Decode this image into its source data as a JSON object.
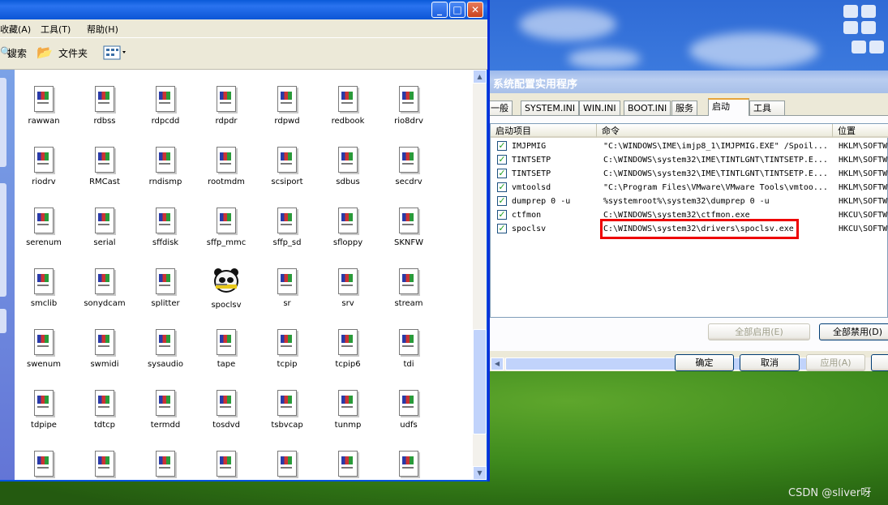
{
  "explorer": {
    "menu": [
      "收藏(A)",
      "工具(T)",
      "帮助(H)"
    ],
    "toolbar": {
      "search_label": "搜索",
      "folders_label": "文件夹"
    },
    "files": [
      [
        "rawwan",
        "rdbss",
        "rdpcdd",
        "rdpdr",
        "rdpwd",
        "redbook",
        "rio8drv"
      ],
      [
        "riodrv",
        "RMCast",
        "rndismp",
        "rootmdm",
        "scsiport",
        "sdbus",
        "secdrv"
      ],
      [
        "serenum",
        "serial",
        "sffdisk",
        "sffp_mmc",
        "sffp_sd",
        "sfloppy",
        "SKNFW"
      ],
      [
        "smclib",
        "sonydcam",
        "splitter",
        "spoclsv",
        "sr",
        "srv",
        "stream"
      ],
      [
        "swenum",
        "swmidi",
        "sysaudio",
        "tape",
        "tcpip",
        "tcpip6",
        "tdi"
      ],
      [
        "tdpipe",
        "tdtcp",
        "termdd",
        "tosdvd",
        "tsbvcap",
        "tunmp",
        "udfs"
      ]
    ]
  },
  "dialog": {
    "title": "系统配置实用程序",
    "tabs": [
      "一般",
      "SYSTEM.INI",
      "WIN.INI",
      "BOOT.INI",
      "服务",
      "启动",
      "工具"
    ],
    "active_tab": "启动",
    "columns": [
      "启动项目",
      "命令",
      "位置"
    ],
    "rows": [
      {
        "checked": true,
        "item": "IMJPMIG",
        "command": "\"C:\\WINDOWS\\IME\\imjp8_1\\IMJPMIG.EXE\" /Spoil...",
        "location": "HKLM\\SOFTW..."
      },
      {
        "checked": true,
        "item": "TINTSETP",
        "command": "C:\\WINDOWS\\system32\\IME\\TINTLGNT\\TINTSETP.E...",
        "location": "HKLM\\SOFTW..."
      },
      {
        "checked": true,
        "item": "TINTSETP",
        "command": "C:\\WINDOWS\\system32\\IME\\TINTLGNT\\TINTSETP.E...",
        "location": "HKLM\\SOFTW..."
      },
      {
        "checked": true,
        "item": "vmtoolsd",
        "command": "\"C:\\Program Files\\VMware\\VMware Tools\\vmtoo...",
        "location": "HKLM\\SOFTW..."
      },
      {
        "checked": true,
        "item": "dumprep 0 -u",
        "command": "%systemroot%\\system32\\dumprep 0 -u",
        "location": "HKLM\\SOFTW..."
      },
      {
        "checked": true,
        "item": "ctfmon",
        "command": "C:\\WINDOWS\\system32\\ctfmon.exe",
        "location": "HKCU\\SOFTW..."
      },
      {
        "checked": true,
        "item": "spoclsv",
        "command": "C:\\WINDOWS\\system32\\drivers\\spoclsv.exe",
        "location": "HKCU\\SOFTW..."
      }
    ],
    "buttons": {
      "enable_all": "全部启用(E)",
      "disable_all": "全部禁用(D)",
      "ok": "确定",
      "cancel": "取消",
      "apply": "应用(A)"
    }
  },
  "watermark": "CSDN @sliver呀"
}
